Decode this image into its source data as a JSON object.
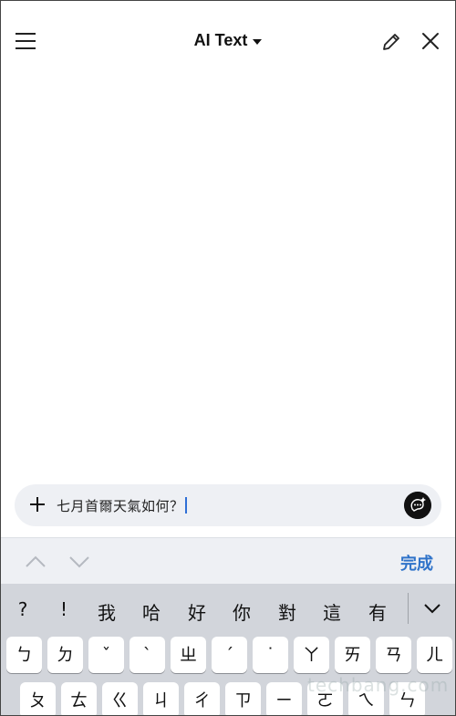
{
  "header": {
    "title": "AI Text"
  },
  "input": {
    "value": "七月首爾天氣如何？"
  },
  "toolbar": {
    "done_label": "完成"
  },
  "keyboard": {
    "candidates": [
      "?",
      "!",
      "我",
      "哈",
      "好",
      "你",
      "對",
      "這",
      "有"
    ],
    "row1": [
      "ㄅ",
      "ㄉ",
      "ˇ",
      "ˋ",
      "ㄓ",
      "ˊ",
      "˙",
      "ㄚ",
      "ㄞ",
      "ㄢ",
      "ㄦ"
    ],
    "row2": [
      "ㄆ",
      "ㄊ",
      "ㄍ",
      "ㄐ",
      "ㄔ",
      "ㄗ",
      "ㄧ",
      "ㄛ",
      "ㄟ",
      "ㄣ"
    ]
  },
  "watermark": {
    "text": "techbang.com"
  },
  "colors": {
    "accent": "#2f73c9",
    "keyboard_bg": "#d2d5db",
    "input_bg": "#eef0f4"
  }
}
